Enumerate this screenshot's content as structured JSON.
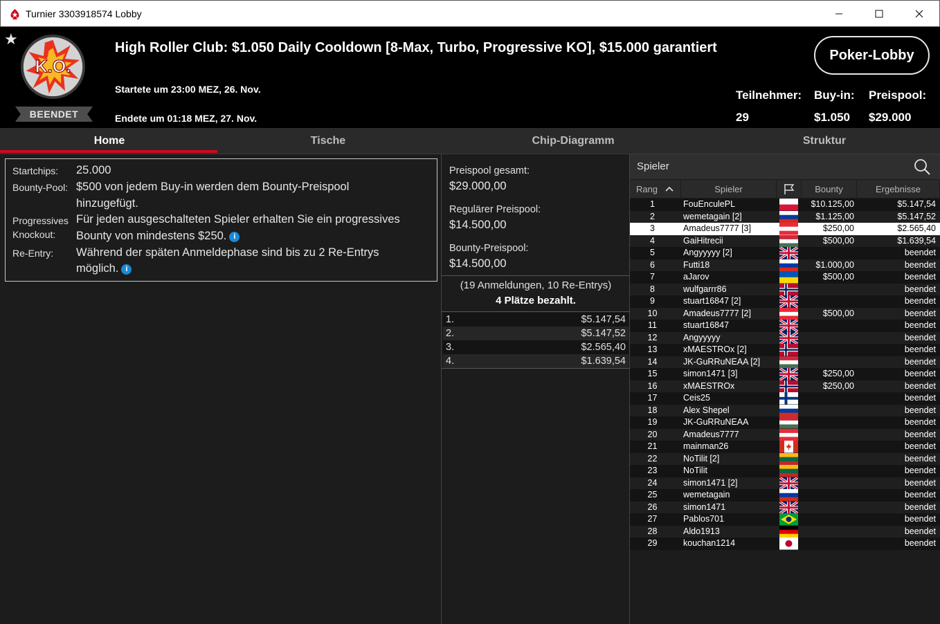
{
  "window": {
    "title": "Turnier 3303918574 Lobby",
    "minimize": "—",
    "maximize": "☐",
    "close": "✕"
  },
  "header": {
    "tournament_title": "High Roller Club: $1.050 Daily Cooldown [8-Max, Turbo, Progressive KO], $15.000 garantiert",
    "start_time": "Startete um 23:00 MEZ, 26. Nov.",
    "end_time": "Endete um 01:18 MEZ, 27. Nov.",
    "status": "BEENDET",
    "logo_text": "K.O.",
    "lobby_button": "Poker-Lobby",
    "stats": {
      "participants_label": "Teilnehmer:",
      "participants_value": "29",
      "buyin_label": "Buy-in:",
      "buyin_value": "$1.050",
      "prizepool_label": "Preispool:",
      "prizepool_value": "$29.000"
    }
  },
  "tabs": [
    "Home",
    "Tische",
    "Chip-Diagramm",
    "Struktur"
  ],
  "info": {
    "startchips_label": "Startchips:",
    "startchips_value": "25.000",
    "bountypool_label": "Bounty-Pool:",
    "bountypool_value_line1": "$500 von jedem Buy-in werden dem Bounty-Preispool",
    "bountypool_value_line2": "hinzugefügt.",
    "progressive_label_line1": "Progressives",
    "progressive_label_line2": "Knockout:",
    "progressive_value_line1": "Für jeden ausgeschalteten Spieler erhalten Sie ein progressives",
    "progressive_value_line2": "Bounty von mindestens $250.",
    "reentry_label": "Re-Entry:",
    "reentry_value_line1": "Während der späten Anmeldephase sind bis zu 2 Re-Entrys",
    "reentry_value_line2": "möglich."
  },
  "prize": {
    "total_label": "Preispool gesamt:",
    "total_value": "$29.000,00",
    "regular_label": "Regulärer Preispool:",
    "regular_value": "$14.500,00",
    "bounty_label": "Bounty-Preispool:",
    "bounty_value": "$14.500,00",
    "entries": "(19 Anmeldungen, 10 Re-Entrys)",
    "paid": "4 Plätze bezahlt.",
    "payouts": [
      {
        "place": "1.",
        "amount": "$5.147,54"
      },
      {
        "place": "2.",
        "amount": "$5.147,52"
      },
      {
        "place": "3.",
        "amount": "$2.565,40"
      },
      {
        "place": "4.",
        "amount": "$1.639,54"
      }
    ]
  },
  "players": {
    "title": "Spieler",
    "columns": {
      "rank": "Rang",
      "player": "Spieler",
      "bounty": "Bounty",
      "result": "Ergebnisse"
    },
    "selected_rank": "3",
    "rows": [
      {
        "rank": "1",
        "name": "FouEnculePL",
        "flag": "poland",
        "bounty": "$10.125,00",
        "result": "$5.147,54"
      },
      {
        "rank": "2",
        "name": "wemetagain [2]",
        "flag": "russia",
        "bounty": "$1.125,00",
        "result": "$5.147,52"
      },
      {
        "rank": "3",
        "name": "Amadeus7777 [3]",
        "flag": "austria",
        "bounty": "$250,00",
        "result": "$2.565,40"
      },
      {
        "rank": "4",
        "name": "GaiHitrecii",
        "flag": "hungary",
        "bounty": "$500,00",
        "result": "$1.639,54"
      },
      {
        "rank": "5",
        "name": "Angyyyyy [2]",
        "flag": "uk",
        "bounty": "",
        "result": "beendet"
      },
      {
        "rank": "6",
        "name": "Futti18",
        "flag": "russia",
        "bounty": "$1.000,00",
        "result": "beendet"
      },
      {
        "rank": "7",
        "name": "aJarov",
        "flag": "ukraine",
        "bounty": "$500,00",
        "result": "beendet"
      },
      {
        "rank": "8",
        "name": "wulfgarrr86",
        "flag": "norway",
        "bounty": "",
        "result": "beendet"
      },
      {
        "rank": "9",
        "name": "stuart16847 [2]",
        "flag": "uk",
        "bounty": "",
        "result": "beendet"
      },
      {
        "rank": "10",
        "name": "Amadeus7777 [2]",
        "flag": "austria",
        "bounty": "$500,00",
        "result": "beendet"
      },
      {
        "rank": "11",
        "name": "stuart16847",
        "flag": "uk",
        "bounty": "",
        "result": "beendet"
      },
      {
        "rank": "12",
        "name": "Angyyyyy",
        "flag": "uk",
        "bounty": "",
        "result": "beendet"
      },
      {
        "rank": "13",
        "name": "xMAESTROx [2]",
        "flag": "norway",
        "bounty": "",
        "result": "beendet"
      },
      {
        "rank": "14",
        "name": "JK-GuRRuNEAA [2]",
        "flag": "hungary",
        "bounty": "",
        "result": "beendet"
      },
      {
        "rank": "15",
        "name": "simon1471 [3]",
        "flag": "uk",
        "bounty": "$250,00",
        "result": "beendet"
      },
      {
        "rank": "16",
        "name": "xMAESTROx",
        "flag": "norway",
        "bounty": "$250,00",
        "result": "beendet"
      },
      {
        "rank": "17",
        "name": "Ceis25",
        "flag": "finland",
        "bounty": "",
        "result": "beendet"
      },
      {
        "rank": "18",
        "name": "Alex Shepel",
        "flag": "russia",
        "bounty": "",
        "result": "beendet"
      },
      {
        "rank": "19",
        "name": "JK-GuRRuNEAA",
        "flag": "hungary",
        "bounty": "",
        "result": "beendet"
      },
      {
        "rank": "20",
        "name": "Amadeus7777",
        "flag": "austria",
        "bounty": "",
        "result": "beendet"
      },
      {
        "rank": "21",
        "name": "mainman26",
        "flag": "canada",
        "bounty": "",
        "result": "beendet"
      },
      {
        "rank": "22",
        "name": "NoTilit [2]",
        "flag": "lithuania",
        "bounty": "",
        "result": "beendet"
      },
      {
        "rank": "23",
        "name": "NoTilit",
        "flag": "lithuania",
        "bounty": "",
        "result": "beendet"
      },
      {
        "rank": "24",
        "name": "simon1471 [2]",
        "flag": "uk",
        "bounty": "",
        "result": "beendet"
      },
      {
        "rank": "25",
        "name": "wemetagain",
        "flag": "russia",
        "bounty": "",
        "result": "beendet"
      },
      {
        "rank": "26",
        "name": "simon1471",
        "flag": "uk",
        "bounty": "",
        "result": "beendet"
      },
      {
        "rank": "27",
        "name": "Pablos701",
        "flag": "brazil",
        "bounty": "",
        "result": "beendet"
      },
      {
        "rank": "28",
        "name": "Aldo1913",
        "flag": "germany",
        "bounty": "",
        "result": "beendet"
      },
      {
        "rank": "29",
        "name": "kouchan1214",
        "flag": "japan",
        "bounty": "",
        "result": "beendet"
      }
    ]
  },
  "colors": {
    "accent_red": "#d10a1e",
    "info_icon_blue": "#1a8ad4",
    "header_bg": "#000000",
    "panel_bg": "#1c1c1c"
  }
}
